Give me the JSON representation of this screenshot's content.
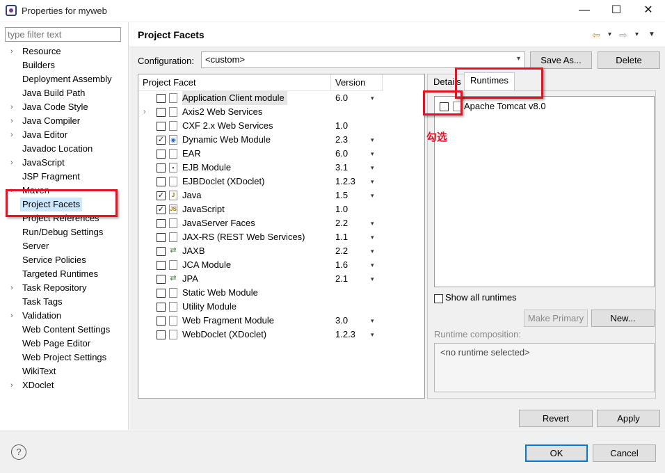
{
  "window": {
    "title": "Properties for myweb",
    "minimize": "—",
    "maximize": "☐",
    "close": "✕"
  },
  "filter": {
    "placeholder": "type filter text"
  },
  "nav": [
    {
      "label": "Resource",
      "expandable": true
    },
    {
      "label": "Builders",
      "expandable": false
    },
    {
      "label": "Deployment Assembly",
      "expandable": false
    },
    {
      "label": "Java Build Path",
      "expandable": false
    },
    {
      "label": "Java Code Style",
      "expandable": true
    },
    {
      "label": "Java Compiler",
      "expandable": true
    },
    {
      "label": "Java Editor",
      "expandable": true
    },
    {
      "label": "Javadoc Location",
      "expandable": false
    },
    {
      "label": "JavaScript",
      "expandable": true
    },
    {
      "label": "JSP Fragment",
      "expandable": false
    },
    {
      "label": "Maven",
      "expandable": true
    },
    {
      "label": "Project Facets",
      "expandable": false,
      "selected": true
    },
    {
      "label": "Project References",
      "expandable": false
    },
    {
      "label": "Run/Debug Settings",
      "expandable": false
    },
    {
      "label": "Server",
      "expandable": false
    },
    {
      "label": "Service Policies",
      "expandable": false
    },
    {
      "label": "Targeted Runtimes",
      "expandable": false
    },
    {
      "label": "Task Repository",
      "expandable": true
    },
    {
      "label": "Task Tags",
      "expandable": false
    },
    {
      "label": "Validation",
      "expandable": true
    },
    {
      "label": "Web Content Settings",
      "expandable": false
    },
    {
      "label": "Web Page Editor",
      "expandable": false
    },
    {
      "label": "Web Project Settings",
      "expandable": false
    },
    {
      "label": "WikiText",
      "expandable": false
    },
    {
      "label": "XDoclet",
      "expandable": true
    }
  ],
  "page": {
    "title": "Project Facets",
    "back_icon": "⇦",
    "forward_icon": "⇨",
    "dropdown_glyph": "▾",
    "menu_glyph": "▼",
    "config_label": "Configuration:",
    "config_value": "<custom>",
    "save_as": "Save As...",
    "delete": "Delete"
  },
  "facets": {
    "col_facet": "Project Facet",
    "col_version": "Version",
    "rows": [
      {
        "name": "Application Client module",
        "version": "6.0",
        "checked": false,
        "dropdown": true,
        "expandable": false,
        "highlight": true,
        "icon": "doc-icon"
      },
      {
        "name": "Axis2 Web Services",
        "version": "",
        "checked": false,
        "dropdown": false,
        "expandable": true,
        "icon": "doc-icon"
      },
      {
        "name": "CXF 2.x Web Services",
        "version": "1.0",
        "checked": false,
        "dropdown": false,
        "expandable": false,
        "icon": "doc-icon"
      },
      {
        "name": "Dynamic Web Module",
        "version": "2.3",
        "checked": true,
        "dropdown": true,
        "expandable": false,
        "icon": "globe-icon"
      },
      {
        "name": "EAR",
        "version": "6.0",
        "checked": false,
        "dropdown": true,
        "expandable": false,
        "icon": "doc-icon"
      },
      {
        "name": "EJB Module",
        "version": "3.1",
        "checked": false,
        "dropdown": true,
        "expandable": false,
        "icon": "bean-icon"
      },
      {
        "name": "EJBDoclet (XDoclet)",
        "version": "1.2.3",
        "checked": false,
        "dropdown": true,
        "expandable": false,
        "icon": "doc-icon"
      },
      {
        "name": "Java",
        "version": "1.5",
        "checked": true,
        "dropdown": true,
        "expandable": false,
        "icon": "java-icon"
      },
      {
        "name": "JavaScript",
        "version": "1.0",
        "checked": true,
        "dropdown": false,
        "expandable": false,
        "icon": "js-icon"
      },
      {
        "name": "JavaServer Faces",
        "version": "2.2",
        "checked": false,
        "dropdown": true,
        "expandable": false,
        "icon": "doc-icon"
      },
      {
        "name": "JAX-RS (REST Web Services)",
        "version": "1.1",
        "checked": false,
        "dropdown": true,
        "expandable": false,
        "icon": "doc-icon"
      },
      {
        "name": "JAXB",
        "version": "2.2",
        "checked": false,
        "dropdown": true,
        "expandable": false,
        "icon": "arrows-icon"
      },
      {
        "name": "JCA Module",
        "version": "1.6",
        "checked": false,
        "dropdown": true,
        "expandable": false,
        "icon": "doc-icon"
      },
      {
        "name": "JPA",
        "version": "2.1",
        "checked": false,
        "dropdown": true,
        "expandable": false,
        "icon": "arrows-icon"
      },
      {
        "name": "Static Web Module",
        "version": "",
        "checked": false,
        "dropdown": false,
        "expandable": false,
        "icon": "doc-icon"
      },
      {
        "name": "Utility Module",
        "version": "",
        "checked": false,
        "dropdown": false,
        "expandable": false,
        "icon": "doc-icon"
      },
      {
        "name": "Web Fragment Module",
        "version": "3.0",
        "checked": false,
        "dropdown": true,
        "expandable": false,
        "icon": "doc-icon"
      },
      {
        "name": "WebDoclet (XDoclet)",
        "version": "1.2.3",
        "checked": false,
        "dropdown": true,
        "expandable": false,
        "icon": "doc-icon"
      }
    ]
  },
  "tabs": {
    "details": "Details",
    "runtimes": "Runtimes"
  },
  "runtimes": {
    "items": [
      {
        "label": "Apache Tomcat v8.0",
        "checked": false
      }
    ],
    "show_all": "Show all runtimes",
    "make_primary": "Make Primary",
    "new": "New...",
    "composition_label": "Runtime composition:",
    "composition_value": "<no runtime selected>"
  },
  "annotation": {
    "text": "勾选",
    "color": "#e81123"
  },
  "buttons": {
    "revert": "Revert",
    "apply": "Apply",
    "ok": "OK",
    "cancel": "Cancel",
    "help": "?"
  },
  "glyphs": {
    "chevron": "›",
    "check": "✓",
    "dropdown": "▾"
  }
}
